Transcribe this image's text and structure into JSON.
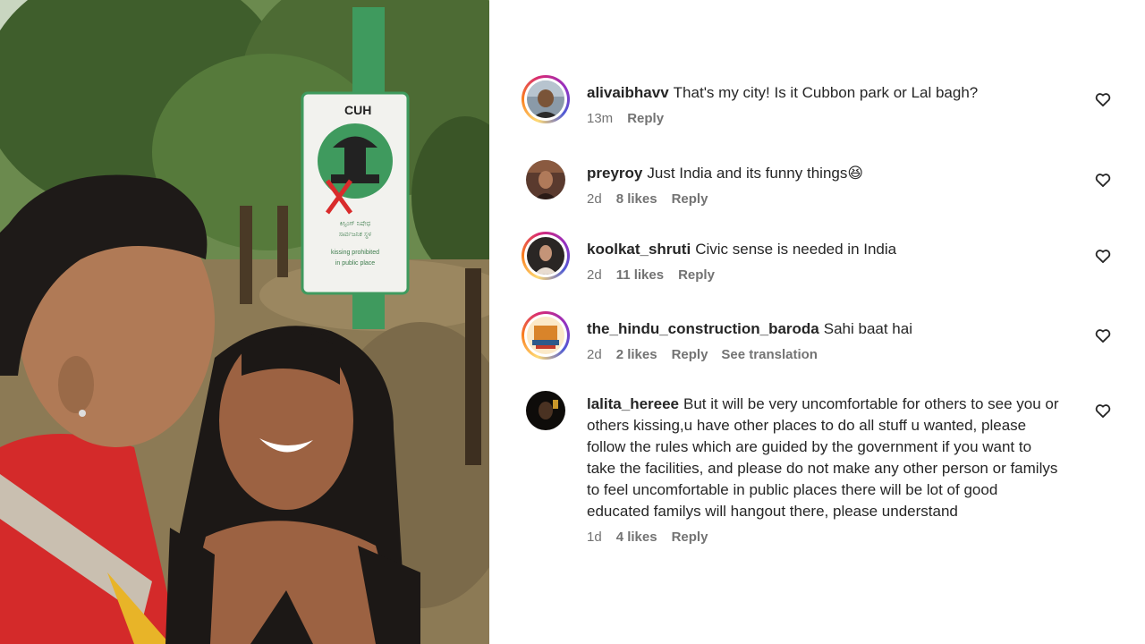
{
  "photo": {
    "sign_header": "CUH",
    "sign_text_line1": "ಕಿಸ್ಸಿಂಗ್ ನಿಷೇಧ",
    "sign_text_line2": "ಸಾರ್ವಜನಿಕ ಸ್ಥಳ",
    "sign_text_line3": "kissing prohibited",
    "sign_text_line4": "in public place"
  },
  "comments": [
    {
      "username": "alivaibhavv",
      "text": "That's my city! Is it Cubbon park or Lal bagh?",
      "time": "13m",
      "likes": "",
      "reply_label": "Reply",
      "translation_label": "",
      "avatar_ring": true,
      "avatar_icon": "profile-photo"
    },
    {
      "username": "preyroy",
      "text": "Just India and its funny things😆",
      "time": "2d",
      "likes": "8 likes",
      "reply_label": "Reply",
      "translation_label": "",
      "avatar_ring": false,
      "avatar_icon": "profile-photo"
    },
    {
      "username": "koolkat_shruti",
      "text": "Civic sense is needed in India",
      "time": "2d",
      "likes": "11 likes",
      "reply_label": "Reply",
      "translation_label": "",
      "avatar_ring": true,
      "avatar_icon": "profile-photo"
    },
    {
      "username": "the_hindu_construction_baroda",
      "text": "Sahi baat hai",
      "time": "2d",
      "likes": "2 likes",
      "reply_label": "Reply",
      "translation_label": "See translation",
      "avatar_ring": true,
      "avatar_icon": "business-logo"
    },
    {
      "username": "lalita_hereee",
      "text": "But it will be very uncomfortable for others to see you or others kissing,u have other places to do all stuff u wanted, please follow the rules which are guided by the government if you want to take the facilities, and please do not make any other person or familys to feel uncomfortable in public places there will be lot of good educated familys will hangout there, please understand",
      "time": "1d",
      "likes": "4 likes",
      "reply_label": "Reply",
      "translation_label": "",
      "avatar_ring": false,
      "avatar_icon": "profile-photo"
    }
  ],
  "icons": {
    "like": "heart-outline-icon"
  },
  "colors": {
    "text": "#262626",
    "meta": "#737373",
    "ring_start": "#feda75",
    "ring_end": "#d62976"
  }
}
